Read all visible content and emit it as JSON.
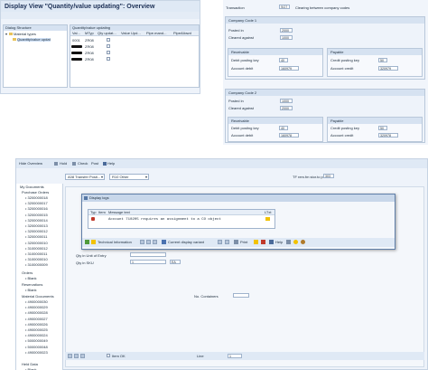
{
  "top_left_window": {
    "title": "Display View \"Quantity/value updating\": Overview",
    "tree": {
      "header": "Dialog Structure",
      "root": "Material types",
      "child": "Quantity/value updat"
    },
    "table": {
      "title": "Quantity/value updating",
      "columns": [
        "Val...",
        "MTyp",
        "Qty updat...",
        "Value Upd...",
        "Pipe.mand...",
        "PipeAllowd"
      ],
      "rows": [
        {
          "val": "0001",
          "mtyp": "ZR08"
        },
        {
          "val": "",
          "mtyp": "ZR08"
        },
        {
          "val": "",
          "mtyp": "ZR08"
        },
        {
          "val": "",
          "mtyp": "ZR08"
        }
      ]
    }
  },
  "top_right_window": {
    "transaction_label": "Transaction",
    "transaction_value": "SO7",
    "transaction_text": "Clearing between company codes",
    "company_code_1": {
      "title": "Company Code 1",
      "posted_in_label": "Posted in",
      "posted_in_value": "2000",
      "cleared_against_label": "Cleared against",
      "cleared_against_value": "1000",
      "receivable_title": "Receivable",
      "payable_title": "Payable",
      "debit_key_label": "Debit posting key",
      "debit_key_value": "40",
      "credit_key_label": "Credit posting key",
      "credit_key_value": "50",
      "account_debit_label": "Account debit",
      "account_debit_value": "160979",
      "account_credit_label": "Account credit",
      "account_credit_value": "320979"
    },
    "company_code_2": {
      "title": "Company Code 2",
      "posted_in_label": "Posted in",
      "posted_in_value": "1000",
      "cleared_against_label": "Cleared against",
      "cleared_against_value": "2000",
      "receivable_title": "Receivable",
      "payable_title": "Payable",
      "debit_key_label": "Debit posting key",
      "debit_key_value": "40",
      "credit_key_label": "Credit posting key",
      "credit_key_value": "50",
      "account_debit_label": "Account debit",
      "account_debit_value": "160978",
      "account_credit_label": "Account credit",
      "account_credit_value": "320978"
    }
  },
  "bottom_window": {
    "toolbar": {
      "hide_overview": "Hide Overview",
      "hold": "Hold",
      "check": "Check",
      "post": "Post",
      "help": "Help"
    },
    "transfer_select": "A08 Transfer Posti...",
    "r10_select": "R10 Other",
    "tf_label": "TF rem.fm stor.to pl",
    "tf_value": "303",
    "tree": {
      "my_documents": "My Documents",
      "purchase_orders": "Purchase Orders",
      "po_items": [
        "3200000018",
        "3200000017",
        "3200000016",
        "3200000015",
        "3200000014",
        "3200000013",
        "3200000012",
        "3200000011",
        "3200000010",
        "3100000012",
        "3100000011",
        "3100000010",
        "3100000009"
      ],
      "orders": "Orders",
      "orders_items": [
        "Blank"
      ],
      "reservations": "Reservations",
      "reservations_items": [
        "Blank"
      ],
      "material_documents": "Material Documents",
      "md_items": [
        "4900000030",
        "4900000029",
        "4900000028",
        "4900000027",
        "4900000026",
        "4900000025",
        "4900000024",
        "5000000049",
        "5000000048",
        "4900000023"
      ],
      "held_data": "Held Data",
      "held_items": [
        "Blank"
      ]
    },
    "form": {
      "qty_unit_entry_label": "Qty in Unit of Entry",
      "qty_sku_label": "Qty in SKU",
      "qty_sku_value": "1",
      "qty_sku_unit": "EA",
      "containers_label": "No. Containers",
      "item_ok_label": "Item OK",
      "line_label": "Line",
      "line_value": "1"
    },
    "dialog": {
      "title": "Display logs",
      "columns": [
        "Typ",
        "Item",
        "Message text",
        "LTxt"
      ],
      "message": "Account 710205 requires an assignment to a CO object",
      "technical_info_button": "Technical Information",
      "current_variant_button": "Current display variant",
      "print_button": "Print",
      "help_button": "Help"
    }
  },
  "colors": {
    "sap_header": "#dfe9f5",
    "group_bg": "#eef3fa",
    "error_red": "#c0392b",
    "accent_yellow": "#f2c200"
  }
}
